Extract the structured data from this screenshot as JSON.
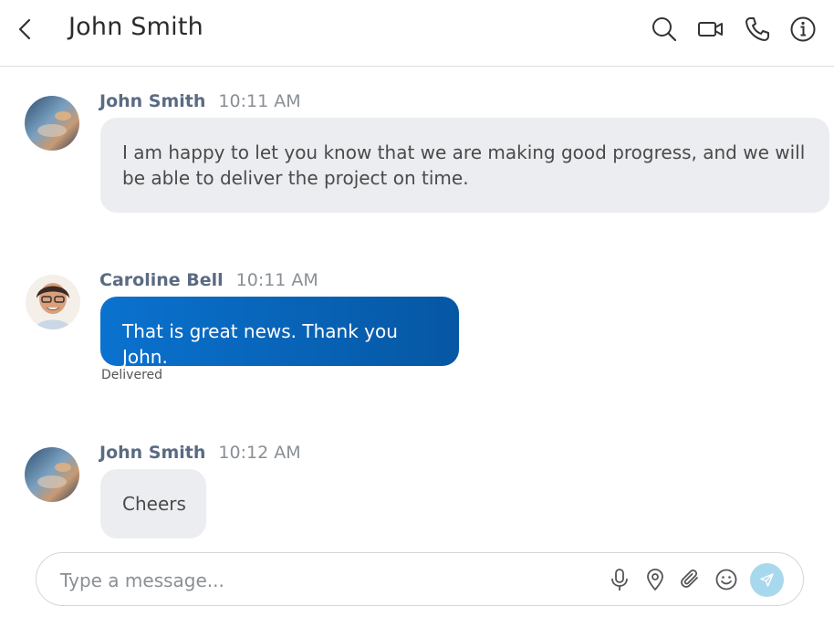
{
  "header": {
    "title": "John Smith",
    "icons": [
      "chevron-left-icon",
      "search-icon",
      "video-call-icon",
      "phone-icon",
      "info-icon"
    ]
  },
  "messages": [
    {
      "sender": "John Smith",
      "time": "10:11 AM",
      "text_lines": [
        "I am happy to let you know that we are making good progress, and we will",
        "be able to deliver the project on time."
      ],
      "direction": "incoming"
    },
    {
      "sender": "Caroline Bell",
      "time": "10:11 AM",
      "text": "That is great news. Thank you John.",
      "direction": "outgoing",
      "status": "Delivered"
    },
    {
      "sender": "John Smith",
      "time": "10:12 AM",
      "text": "Cheers",
      "direction": "incoming"
    }
  ],
  "composer": {
    "placeholder": "Type a message...",
    "icons": [
      "microphone-icon",
      "location-pin-icon",
      "paperclip-icon",
      "emoji-icon",
      "send-icon"
    ]
  },
  "colors": {
    "outgoing_bubble_start": "#0a72cf",
    "outgoing_bubble_end": "#0657a3",
    "incoming_bubble": "#ecedf0",
    "sender_name": "#5a6b82",
    "send_button": "#a8d8ee"
  }
}
